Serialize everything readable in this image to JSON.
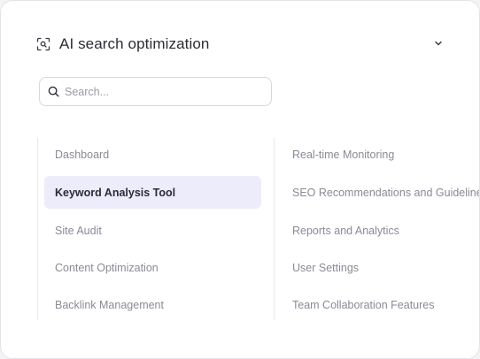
{
  "header": {
    "title": "AI search optimization",
    "icon": "scan-search-icon",
    "collapse_icon": "chevron-down-icon"
  },
  "search": {
    "placeholder": "Search...",
    "value": "",
    "icon": "search-icon"
  },
  "menu": {
    "left": [
      {
        "label": "Dashboard",
        "active": false
      },
      {
        "label": "Keyword Analysis Tool",
        "active": true
      },
      {
        "label": "Site Audit",
        "active": false
      },
      {
        "label": "Content Optimization",
        "active": false
      },
      {
        "label": "Backlink Management",
        "active": false
      }
    ],
    "right": [
      {
        "label": "Real-time Monitoring",
        "active": false
      },
      {
        "label": "SEO Recommendations and Guidelines",
        "active": false
      },
      {
        "label": "Reports and Analytics",
        "active": false
      },
      {
        "label": "User Settings",
        "active": false
      },
      {
        "label": "Team Collaboration Features",
        "active": false
      }
    ]
  },
  "colors": {
    "active_bg": "#ececfb",
    "text_muted": "#8a8a98",
    "text_strong": "#2b2b36",
    "border": "#e3e3e8"
  }
}
